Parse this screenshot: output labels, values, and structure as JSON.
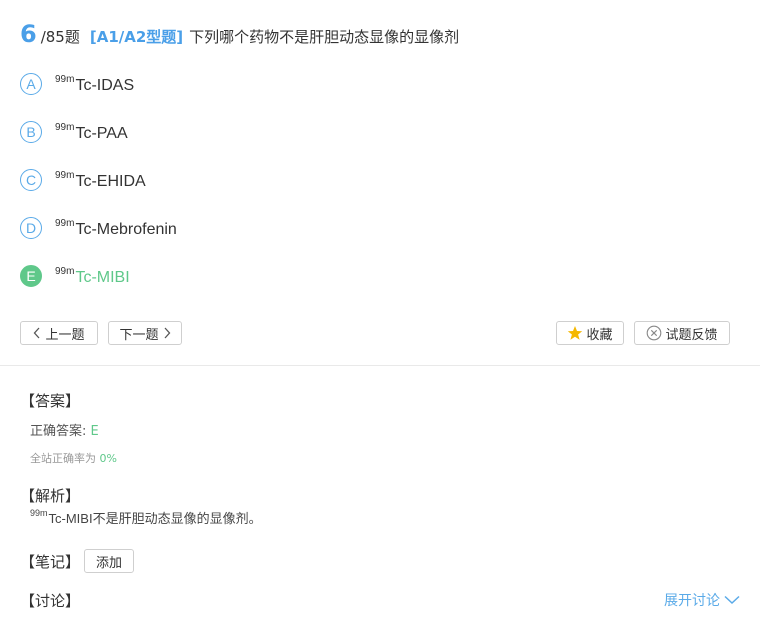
{
  "question": {
    "number": "6",
    "total": "/85题",
    "type": "[A1/A2型题]",
    "text": "下列哪个药物不是肝胆动态显像的显像剂"
  },
  "options": [
    {
      "letter": "A",
      "sup": "99m",
      "text": "Tc-IDAS"
    },
    {
      "letter": "B",
      "sup": "99m",
      "text": "Tc-PAA"
    },
    {
      "letter": "C",
      "sup": "99m",
      "text": "Tc-EHIDA"
    },
    {
      "letter": "D",
      "sup": "99m",
      "text": "Tc-Mebrofenin"
    },
    {
      "letter": "E",
      "sup": "99m",
      "text": "Tc-MIBI"
    }
  ],
  "nav": {
    "prev": "上一题",
    "next": "下一题",
    "favorite": "收藏",
    "feedback": "试题反馈"
  },
  "answer": {
    "title": "【答案】",
    "label": "正确答案:",
    "value": "E",
    "rate_label": "全站正确率为",
    "rate_value": "0%"
  },
  "analysis": {
    "title": "【解析】",
    "sup": "99m",
    "text": "Tc-MIBI不是肝胆动态显像的显像剂。"
  },
  "notes": {
    "title": "【笔记】",
    "add": "添加"
  },
  "discussion": {
    "title": "【讨论】",
    "expand": "展开讨论"
  },
  "colors": {
    "accent": "#4a9fe8",
    "correct": "#5fc88a",
    "star": "#f5b800"
  }
}
